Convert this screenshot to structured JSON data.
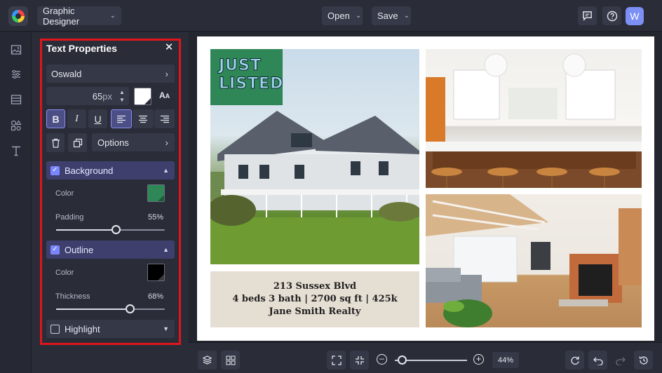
{
  "topbar": {
    "app_name": "Graphic Designer",
    "open_label": "Open",
    "save_label": "Save",
    "avatar_initial": "W",
    "icons": [
      "comment-icon",
      "help-icon"
    ]
  },
  "left_rail": {
    "tools": [
      "image-icon",
      "adjust-icon",
      "layout-icon",
      "shapes-icon",
      "text-icon"
    ]
  },
  "text_properties": {
    "title": "Text Properties",
    "font_family": "Oswald",
    "font_size": "65",
    "font_size_unit": "px",
    "bold": "B",
    "italic": "I",
    "underline": "U",
    "options_label": "Options",
    "background": {
      "label": "Background",
      "enabled": true,
      "color_label": "Color",
      "color": "#2f8757",
      "padding_label": "Padding",
      "padding_value": "55%",
      "padding_fraction": 0.55
    },
    "outline": {
      "label": "Outline",
      "enabled": true,
      "color_label": "Color",
      "color": "#000000",
      "thickness_label": "Thickness",
      "thickness_value": "68%",
      "thickness_fraction": 0.68
    },
    "highlight": {
      "label": "Highlight",
      "enabled": false
    }
  },
  "canvas": {
    "badge_line1": "JUST",
    "badge_line2": "LISTED",
    "badge_color": "#2f8757",
    "address": "213 Sussex Blvd",
    "details": "4 beds 3 bath | 2700 sq ft | 425k",
    "agent": "Jane Smith Realty"
  },
  "bottombar": {
    "zoom_value": "44",
    "zoom_unit": "%",
    "zoom_fraction": 0.1
  },
  "colors": {
    "accent": "#7a86ff",
    "highlight_frame": "#e0151b"
  }
}
